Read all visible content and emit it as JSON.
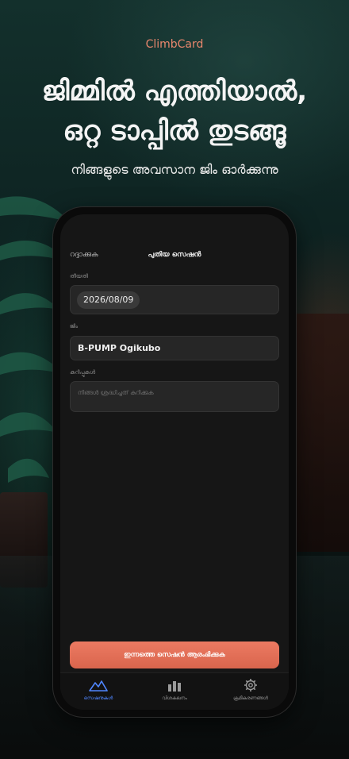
{
  "brand": "ClimbCard",
  "headline": {
    "line1": "ജിമ്മിൽ എത്തിയാൽ,",
    "line2": "ഒറ്റ ടാപ്പിൽ തുടങ്ങൂ"
  },
  "subheadline": "നിങ്ങളുടെ അവസാന ജിം ഓർക്കുന്നു",
  "screen": {
    "cancel": "റദ്ദാക്കുക",
    "title": "പുതിയ സെഷൻ",
    "date": {
      "label": "തീയതി",
      "value": "2026/08/09"
    },
    "gym": {
      "label": "ജിം",
      "value": "B-PUMP Ogikubo"
    },
    "notes": {
      "label": "കുറിപ്പുകൾ",
      "placeholder": "നിങ്ങൾ ശ്രദ്ധിച്ചത് കുറിക്കുക"
    },
    "start_button": "ഇന്നത്തെ സെഷൻ ആരംഭിക്കുക"
  },
  "tabs": [
    {
      "label": "സെഷനുകൾ",
      "icon": "mountain-icon",
      "active": true
    },
    {
      "label": "വിശകലനം",
      "icon": "bar-chart-icon",
      "active": false
    },
    {
      "label": "ക്രമീകരണങ്ങൾ",
      "icon": "gear-icon",
      "active": false
    }
  ],
  "colors": {
    "accent": "#e9876d",
    "button": "#e0705a",
    "active_tab": "#4f86ff"
  }
}
